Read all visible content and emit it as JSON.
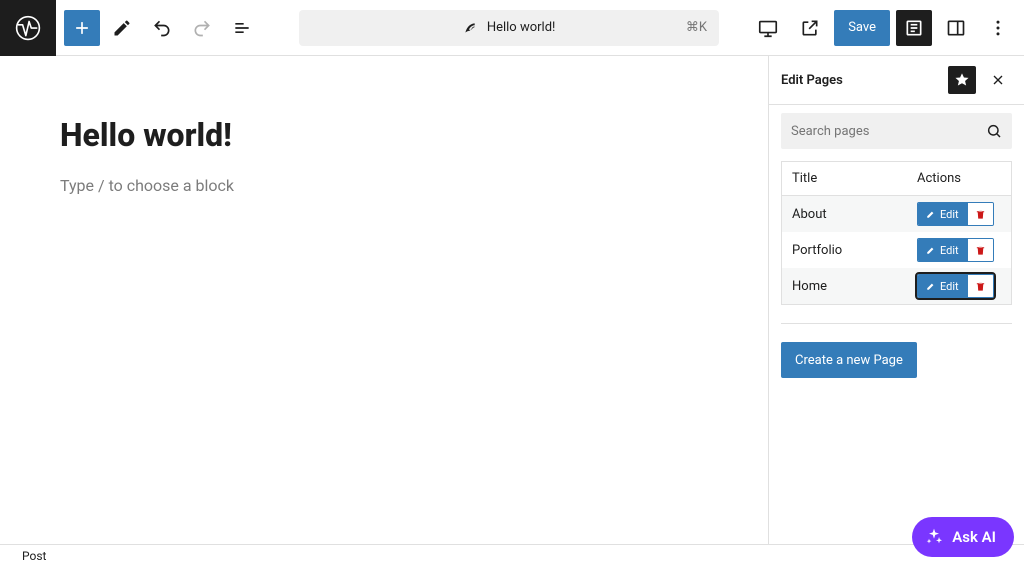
{
  "topbar": {
    "doc_title": "Hello world!",
    "shortcut": "⌘K",
    "save_label": "Save"
  },
  "editor": {
    "title": "Hello world!",
    "placeholder": "Type / to choose a block"
  },
  "sidebar": {
    "title": "Edit Pages",
    "search_placeholder": "Search pages",
    "col_title": "Title",
    "col_actions": "Actions",
    "rows": [
      {
        "title": "About",
        "edit": "Edit"
      },
      {
        "title": "Portfolio",
        "edit": "Edit"
      },
      {
        "title": "Home",
        "edit": "Edit"
      }
    ],
    "create_label": "Create a new Page"
  },
  "footer": {
    "label": "Post"
  },
  "ask_ai": {
    "label": "Ask AI"
  }
}
